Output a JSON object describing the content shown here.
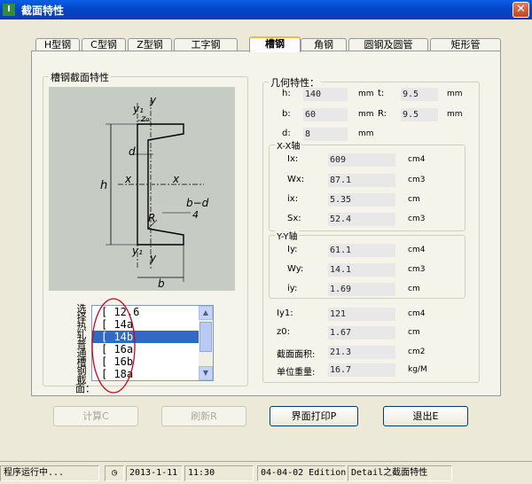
{
  "window": {
    "title": "截面特性",
    "app_icon": "I",
    "close": "✕"
  },
  "tabs": [
    {
      "label": "H型钢"
    },
    {
      "label": "C型钢"
    },
    {
      "label": "Z型钢"
    },
    {
      "label": "工字钢"
    },
    {
      "label": "槽钢"
    },
    {
      "label": "角钢"
    },
    {
      "label": "圆钢及圆管"
    },
    {
      "label": "矩形管"
    }
  ],
  "section_group": {
    "title": "槽钢截面特性"
  },
  "diagram_labels": {
    "y1": "y₁",
    "y": "y",
    "z0": "z₀",
    "d": "d",
    "h": "h",
    "x": "x",
    "R": "R",
    "bd": "b−d",
    "four": "4",
    "b": "b"
  },
  "select_label": "选择热轧普通槽钢截面：",
  "list_items": [
    "[ 12.6",
    "[ 14a",
    "[ 14b",
    "[ 16a",
    "[ 16b",
    "[ 18a"
  ],
  "selected_index": 2,
  "geometry": {
    "title": "几何特性：",
    "h_label": "h:",
    "h_value": "140",
    "h_unit": "mm",
    "t_label": "t:",
    "t_value": "9.5",
    "t_unit": "mm",
    "b_label": "b:",
    "b_value": "60",
    "b_unit": "mm",
    "R_label": "R:",
    "R_value": "9.5",
    "R_unit": "mm",
    "d_label": "d:",
    "d_value": "8",
    "d_unit": "mm"
  },
  "xx_axis": {
    "title": "X-X轴",
    "Ix_label": "Ix:",
    "Ix_value": "609",
    "Ix_unit": "cm4",
    "Wx_label": "Wx:",
    "Wx_value": "87.1",
    "Wx_unit": "cm3",
    "ix_label": "ix:",
    "ix_value": "5.35",
    "ix_unit": "cm",
    "Sx_label": "Sx:",
    "Sx_value": "52.4",
    "Sx_unit": "cm3"
  },
  "yy_axis": {
    "title": "Y-Y轴",
    "Iy_label": "Iy:",
    "Iy_value": "61.1",
    "Iy_unit": "cm4",
    "Wy_label": "Wy:",
    "Wy_value": "14.1",
    "Wy_unit": "cm3",
    "iy_label": "iy:",
    "iy_value": "1.69",
    "iy_unit": "cm"
  },
  "extra": {
    "Iy1_label": "Iy1:",
    "Iy1_value": "121",
    "Iy1_unit": "cm4",
    "z0_label": "z0:",
    "z0_value": "1.67",
    "z0_unit": "cm",
    "area_label": "截面面积:",
    "area_value": "21.3",
    "area_unit": "cm2",
    "weight_label": "单位重量:",
    "weight_value": "16.7",
    "weight_unit": "kg/M"
  },
  "buttons": {
    "calc": "计算C",
    "refresh": "刷新R",
    "print": "界面打印P",
    "exit": "退出E"
  },
  "status": {
    "running": "程序运行中...",
    "date": "2013-1-11",
    "time": "11:30",
    "edition": "04-04-02 Edition",
    "detail": "Detail之截面特性"
  },
  "colors": {
    "titlebar": "#0246c8",
    "selection": "#316ac5",
    "diagram_bg": "#c6cbc4",
    "annotation_red": "#d0021b"
  }
}
